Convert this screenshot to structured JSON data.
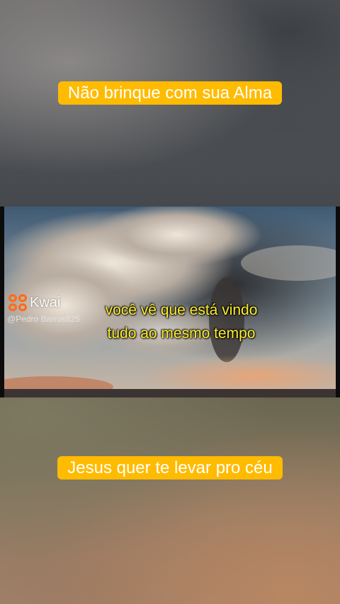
{
  "captions": {
    "top": "Não brinque com sua Alma",
    "bottom": "Jesus quer te levar pro céu"
  },
  "video": {
    "subtitle_line1": "você vê que está vindo",
    "subtitle_line2": "tudo ao mesmo tempo",
    "watermark": {
      "brand": "Kwai",
      "username": "@Pedro Barros825",
      "logo_color": "#ff6a1a"
    }
  },
  "colors": {
    "caption_background": "#ffbb00",
    "subtitle_text": "#ffef2a"
  }
}
